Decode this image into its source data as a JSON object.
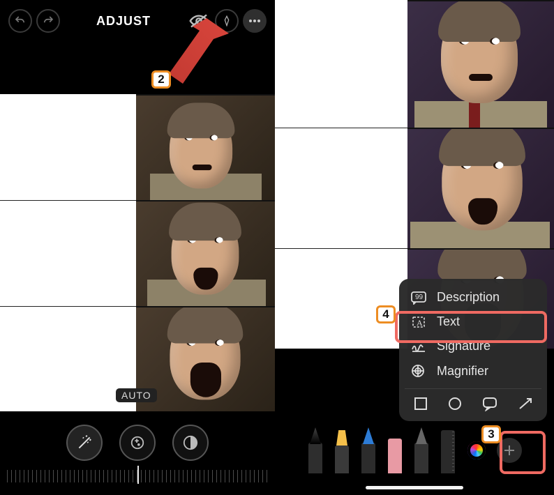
{
  "colors": {
    "step_border": "#ed8d23",
    "highlight": "#ef6a62",
    "arrow": "#cc3b33"
  },
  "steps": {
    "s2": "2",
    "s3": "3",
    "s4": "4"
  },
  "left": {
    "adjust_label": "ADJUST",
    "auto_chip": "AUTO",
    "toolbar_icons": {
      "undo": "undo-icon",
      "redo": "redo-icon",
      "visibility": "eye-off-icon",
      "markup": "markup-pen-icon",
      "more": "more-icon"
    },
    "edit_tools": {
      "magic": "magic-wand-icon",
      "exposure": "exposure-icon",
      "contrast": "contrast-icon"
    }
  },
  "right": {
    "menu": {
      "description": "Description",
      "text": "Text",
      "signature": "Signature",
      "magnifier": "Magnifier"
    },
    "shapes": {
      "square": "square-icon",
      "circle": "circle-icon",
      "speech": "speech-bubble-icon",
      "arrow": "arrow-icon"
    },
    "markup_tools": [
      "pen",
      "marker",
      "pencil",
      "eraser",
      "lasso",
      "ruler"
    ]
  }
}
